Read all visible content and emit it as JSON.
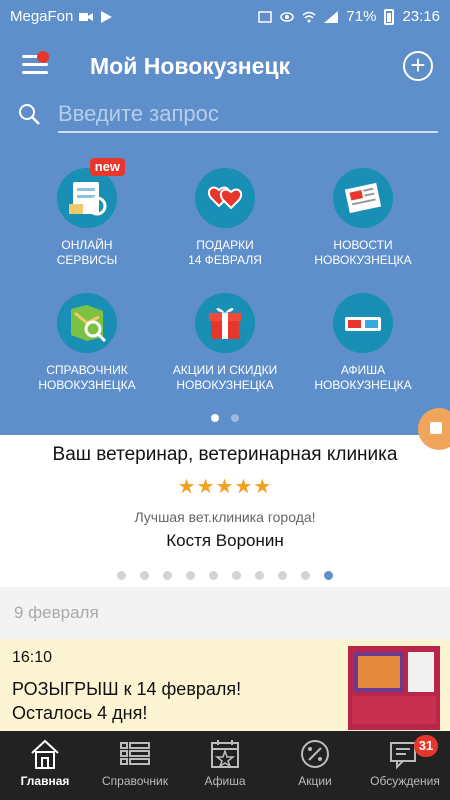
{
  "status_bar": {
    "carrier": "MegaFon",
    "battery": "71%",
    "time": "23:16"
  },
  "header": {
    "title": "Мой Новокузнецк",
    "search_placeholder": "Введите запрос"
  },
  "categories": [
    {
      "line1": "ОНЛАЙН",
      "line2": "СЕРВИСЫ",
      "icon": "online-services-icon",
      "badge": "new"
    },
    {
      "line1": "ПОДАРКИ",
      "line2": "14 ФЕВРАЛЯ",
      "icon": "hearts-icon"
    },
    {
      "line1": "НОВОСТИ",
      "line2": "НОВОКУЗНЕЦКА",
      "icon": "newspaper-icon"
    },
    {
      "line1": "СПРАВОЧНИК",
      "line2": "НОВОКУЗНЕЦКА",
      "icon": "map-icon"
    },
    {
      "line1": "АКЦИИ И СКИДКИ",
      "line2": "НОВОКУЗНЕЦКА",
      "icon": "gift-icon"
    },
    {
      "line1": "АФИША",
      "line2": "НОВОКУЗНЕЦКА",
      "icon": "3d-glasses-icon"
    }
  ],
  "promo": {
    "title": "Ваш ветеринар, ветеринарная клиника",
    "rating": 5,
    "stars": "★★★★★",
    "quote": "Лучшая вет.клиника города!",
    "author": "Костя Воронин"
  },
  "feed": {
    "date": "9 февраля",
    "items": [
      {
        "time": "16:10",
        "line1": "РОЗЫГРЫШ к 14 февраля!",
        "line2": "Осталось 4 дня!"
      }
    ]
  },
  "bottom_nav": [
    {
      "label": "Главная",
      "icon": "home-icon"
    },
    {
      "label": "Справочник",
      "icon": "list-icon"
    },
    {
      "label": "Афиша",
      "icon": "calendar-star-icon"
    },
    {
      "label": "Акции",
      "icon": "percent-icon"
    },
    {
      "label": "Обсуждения",
      "icon": "chat-icon",
      "badge": "31"
    }
  ],
  "colors": {
    "primary": "#5f8fcb",
    "accent_red": "#e7362b",
    "star": "#f2a01f",
    "icon_circle": "#1a8fb5"
  }
}
